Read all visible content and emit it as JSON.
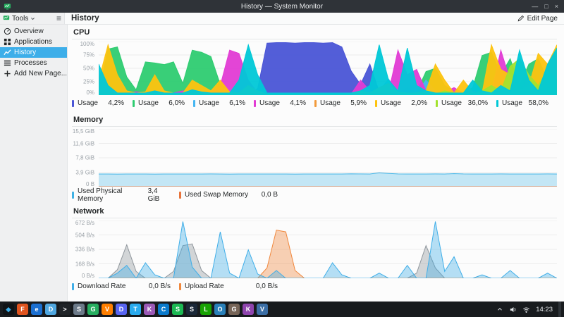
{
  "titlebar": {
    "title": "History — System Monitor",
    "buttons": {
      "minimize": "—",
      "maximize": "□",
      "close": "×"
    }
  },
  "toolbar": {
    "tools_label": "Tools",
    "page_title": "History",
    "edit_button": "Edit Page"
  },
  "sidebar": {
    "items": [
      {
        "label": "Overview",
        "icon": "overview",
        "active": false
      },
      {
        "label": "Applications",
        "icon": "applications",
        "active": false
      },
      {
        "label": "History",
        "icon": "history",
        "active": true
      },
      {
        "label": "Processes",
        "icon": "processes",
        "active": false
      },
      {
        "label": "Add New Page...",
        "icon": "add",
        "active": false
      }
    ]
  },
  "chart_data": [
    {
      "id": "cpu",
      "type": "area",
      "title": "CPU",
      "ylim": [
        0,
        100
      ],
      "yticks": [
        "100%",
        "75%",
        "50%",
        "25%",
        "0%"
      ],
      "grid": true,
      "legend_position": "bottom",
      "fill_opacity": 0.95,
      "series": [
        {
          "name": "Usage",
          "value": "4,2%",
          "color": "#4a55d6",
          "values": [
            2,
            2,
            4,
            6,
            2,
            2,
            2,
            2,
            2,
            2,
            2,
            2,
            2,
            2,
            2,
            2,
            4,
            12,
            97,
            98,
            98,
            97,
            98,
            98,
            97,
            98,
            90,
            45,
            20,
            58,
            6,
            2,
            2,
            2,
            2,
            2,
            2,
            2,
            2,
            2,
            2,
            2,
            2,
            2,
            2,
            2,
            2,
            4,
            4,
            2
          ]
        },
        {
          "name": "Usage",
          "value": "6,0%",
          "color": "#2ecc71",
          "values": [
            4,
            86,
            90,
            34,
            10,
            62,
            60,
            57,
            62,
            22,
            84,
            80,
            72,
            20,
            6,
            4,
            10,
            4,
            2,
            2,
            2,
            2,
            2,
            2,
            2,
            2,
            2,
            4,
            6,
            6,
            10,
            6,
            4,
            14,
            6,
            44,
            50,
            18,
            8,
            4,
            14,
            74,
            80,
            38,
            68,
            18,
            58,
            68,
            28,
            8
          ]
        },
        {
          "name": "Usage",
          "value": "6,1%",
          "color": "#45b6f2",
          "values": [
            8,
            4,
            4,
            4,
            4,
            4,
            6,
            4,
            4,
            4,
            6,
            4,
            4,
            4,
            4,
            4,
            6,
            4,
            2,
            2,
            2,
            2,
            2,
            2,
            2,
            2,
            2,
            2,
            6,
            4,
            8,
            30,
            6,
            4,
            4,
            28,
            8,
            4,
            4,
            4,
            6,
            4,
            4,
            4,
            6,
            4,
            4,
            8,
            6,
            4
          ]
        },
        {
          "name": "Usage",
          "value": "4,1%",
          "color": "#e23bd4",
          "values": [
            4,
            8,
            4,
            4,
            6,
            4,
            4,
            4,
            4,
            8,
            4,
            4,
            8,
            18,
            84,
            78,
            28,
            4,
            2,
            2,
            2,
            2,
            2,
            2,
            2,
            2,
            2,
            2,
            28,
            8,
            4,
            6,
            84,
            38,
            48,
            8,
            4,
            6,
            14,
            4,
            8,
            4,
            6,
            84,
            28,
            4,
            38,
            8,
            4,
            6
          ]
        },
        {
          "name": "Usage",
          "value": "5,9%",
          "color": "#f29b3c",
          "values": [
            3,
            5,
            3,
            3,
            3,
            3,
            3,
            3,
            3,
            3,
            5,
            3,
            3,
            3,
            3,
            3,
            3,
            3,
            2,
            2,
            2,
            2,
            2,
            2,
            2,
            2,
            2,
            3,
            5,
            3,
            3,
            3,
            3,
            3,
            5,
            3,
            3,
            3,
            3,
            3,
            3,
            3,
            5,
            3,
            3,
            3,
            3,
            3,
            5,
            15
          ]
        },
        {
          "name": "Usage",
          "value": "2,0%",
          "color": "#fdc30f",
          "values": [
            28,
            94,
            38,
            8,
            4,
            6,
            38,
            8,
            4,
            4,
            28,
            18,
            8,
            28,
            6,
            4,
            18,
            8,
            2,
            2,
            2,
            2,
            2,
            2,
            2,
            2,
            2,
            2,
            8,
            4,
            14,
            22,
            6,
            4,
            4,
            8,
            58,
            28,
            4,
            28,
            6,
            4,
            94,
            48,
            38,
            8,
            18,
            78,
            58,
            94
          ]
        },
        {
          "name": "Usage",
          "value": "36,0%",
          "color": "#a3e22e",
          "values": [
            2,
            2,
            2,
            2,
            2,
            2,
            2,
            2,
            2,
            2,
            2,
            2,
            2,
            2,
            2,
            2,
            2,
            2,
            2,
            2,
            2,
            2,
            2,
            2,
            2,
            2,
            2,
            2,
            2,
            2,
            2,
            2,
            2,
            2,
            2,
            2,
            2,
            8,
            4,
            2,
            4,
            8,
            18,
            8,
            54,
            68,
            38,
            18,
            48,
            28
          ]
        },
        {
          "name": "Usage",
          "value": "58,0%",
          "color": "#00c8d7",
          "values": [
            58,
            18,
            4,
            4,
            4,
            4,
            8,
            4,
            4,
            4,
            10,
            6,
            4,
            4,
            4,
            28,
            94,
            38,
            4,
            4,
            4,
            4,
            4,
            4,
            4,
            4,
            4,
            4,
            8,
            18,
            94,
            28,
            8,
            88,
            18,
            8,
            4,
            4,
            4,
            4,
            28,
            8,
            4,
            18,
            8,
            84,
            28,
            8,
            58,
            88
          ]
        }
      ]
    },
    {
      "id": "memory",
      "type": "area",
      "title": "Memory",
      "ylim": [
        0,
        15.5
      ],
      "yticks": [
        "15,5 GiB",
        "11,6 GiB",
        "7,8 GiB",
        "3,9 GiB",
        "0 B"
      ],
      "grid": true,
      "legend_position": "bottom",
      "fill_opacity": 0.3,
      "series": [
        {
          "name": "Used Physical Memory",
          "value": "3,4 GiB",
          "color": "#3fb2e5",
          "values": [
            3.4,
            3.4,
            3.38,
            3.4,
            3.41,
            3.4,
            3.39,
            3.4,
            3.4,
            3.41,
            3.4,
            3.4,
            3.42,
            3.4,
            3.39,
            3.4,
            3.4,
            3.41,
            3.4,
            3.4,
            3.4,
            3.38,
            3.4,
            3.4,
            3.41,
            3.4,
            3.4,
            3.45,
            3.42,
            3.4,
            3.7,
            3.55,
            3.42,
            3.4,
            3.41,
            3.4,
            3.42,
            3.4,
            3.5,
            3.42,
            3.4,
            3.41,
            3.4,
            3.42,
            3.4,
            3.4,
            3.41,
            3.4,
            3.42,
            3.4
          ]
        },
        {
          "name": "Used Swap Memory",
          "value": "0,0 B",
          "color": "#e8743b",
          "values": [
            0,
            0,
            0,
            0,
            0,
            0,
            0,
            0,
            0,
            0,
            0,
            0,
            0,
            0,
            0,
            0,
            0,
            0,
            0,
            0,
            0,
            0,
            0,
            0,
            0,
            0,
            0,
            0,
            0,
            0,
            0,
            0,
            0,
            0,
            0,
            0,
            0,
            0,
            0,
            0,
            0,
            0,
            0,
            0,
            0,
            0,
            0,
            0,
            0,
            0
          ]
        }
      ]
    },
    {
      "id": "network",
      "type": "area",
      "title": "Network",
      "ylim": [
        0,
        672
      ],
      "yticks": [
        "672 B/s",
        "504 B/s",
        "336 B/s",
        "168 B/s",
        "0 B/s"
      ],
      "grid": true,
      "legend_position": "bottom",
      "fill_opacity": 0.38,
      "series": [
        {
          "name": "",
          "value": "",
          "color": "#8f969c",
          "values": [
            0,
            0,
            100,
            390,
            80,
            0,
            0,
            0,
            80,
            380,
            400,
            90,
            0,
            0,
            0,
            0,
            0,
            0,
            0,
            0,
            0,
            0,
            0,
            0,
            0,
            0,
            0,
            0,
            0,
            0,
            0,
            0,
            0,
            0,
            60,
            380,
            120,
            0,
            0,
            0,
            0,
            0,
            0,
            0,
            0,
            0,
            0,
            0,
            0,
            0
          ]
        },
        {
          "name": "Upload Rate",
          "value": "0,0 B/s",
          "color": "#f0873c",
          "values": [
            0,
            0,
            0,
            0,
            0,
            0,
            0,
            0,
            0,
            0,
            0,
            0,
            0,
            0,
            0,
            0,
            0,
            0,
            120,
            560,
            540,
            90,
            0,
            0,
            0,
            0,
            0,
            0,
            0,
            0,
            0,
            0,
            0,
            0,
            0,
            0,
            0,
            0,
            0,
            0,
            0,
            0,
            0,
            0,
            0,
            0,
            0,
            0,
            0,
            0
          ]
        },
        {
          "name": "Download Rate",
          "value": "0,0 B/s",
          "color": "#3faee8",
          "values": [
            0,
            0,
            60,
            150,
            0,
            180,
            40,
            0,
            0,
            660,
            130,
            0,
            0,
            540,
            60,
            0,
            330,
            50,
            0,
            90,
            0,
            0,
            0,
            0,
            0,
            180,
            40,
            0,
            0,
            0,
            60,
            0,
            0,
            150,
            0,
            0,
            660,
            80,
            250,
            0,
            0,
            40,
            0,
            0,
            90,
            0,
            0,
            0,
            60,
            0
          ]
        }
      ]
    }
  ],
  "legend_order": {
    "memory": [
      "Used Physical Memory",
      "Used Swap Memory"
    ],
    "network": [
      "Download Rate",
      "Upload Rate"
    ]
  },
  "taskbar": {
    "clock": "14:23",
    "tray_icons": [
      "caret-up-icon",
      "volume-icon",
      "network-icon"
    ],
    "apps": [
      {
        "name": "launcher",
        "glyph": "◆",
        "bg": "#101316",
        "fg": "#3daee9"
      },
      {
        "name": "firefox",
        "glyph": "F",
        "bg": "#e0541f"
      },
      {
        "name": "edge",
        "glyph": "e",
        "bg": "#1b6fd0"
      },
      {
        "name": "dolphin",
        "glyph": "D",
        "bg": "#4fa7e0"
      },
      {
        "name": "konsole",
        "glyph": ">",
        "bg": "#202428"
      },
      {
        "name": "settings",
        "glyph": "S",
        "bg": "#6c7a89"
      },
      {
        "name": "gwenview",
        "glyph": "G",
        "bg": "#27ae60"
      },
      {
        "name": "vlc",
        "glyph": "V",
        "bg": "#ff7f00"
      },
      {
        "name": "discord",
        "glyph": "D",
        "bg": "#5865f2"
      },
      {
        "name": "telegram",
        "glyph": "T",
        "bg": "#2aabee"
      },
      {
        "name": "krita",
        "glyph": "K",
        "bg": "#9b59b6"
      },
      {
        "name": "code",
        "glyph": "C",
        "bg": "#0a7acc"
      },
      {
        "name": "spotify",
        "glyph": "S",
        "bg": "#1db954"
      },
      {
        "name": "steam",
        "glyph": "S",
        "bg": "#1b2838"
      },
      {
        "name": "libreoffice",
        "glyph": "L",
        "bg": "#18a303"
      },
      {
        "name": "okular",
        "glyph": "O",
        "bg": "#2980b9"
      },
      {
        "name": "gimp",
        "glyph": "G",
        "bg": "#766457"
      },
      {
        "name": "kdenlive",
        "glyph": "K",
        "bg": "#8e44ad"
      },
      {
        "name": "virtualbox",
        "glyph": "V",
        "bg": "#3b6ea5"
      }
    ]
  }
}
